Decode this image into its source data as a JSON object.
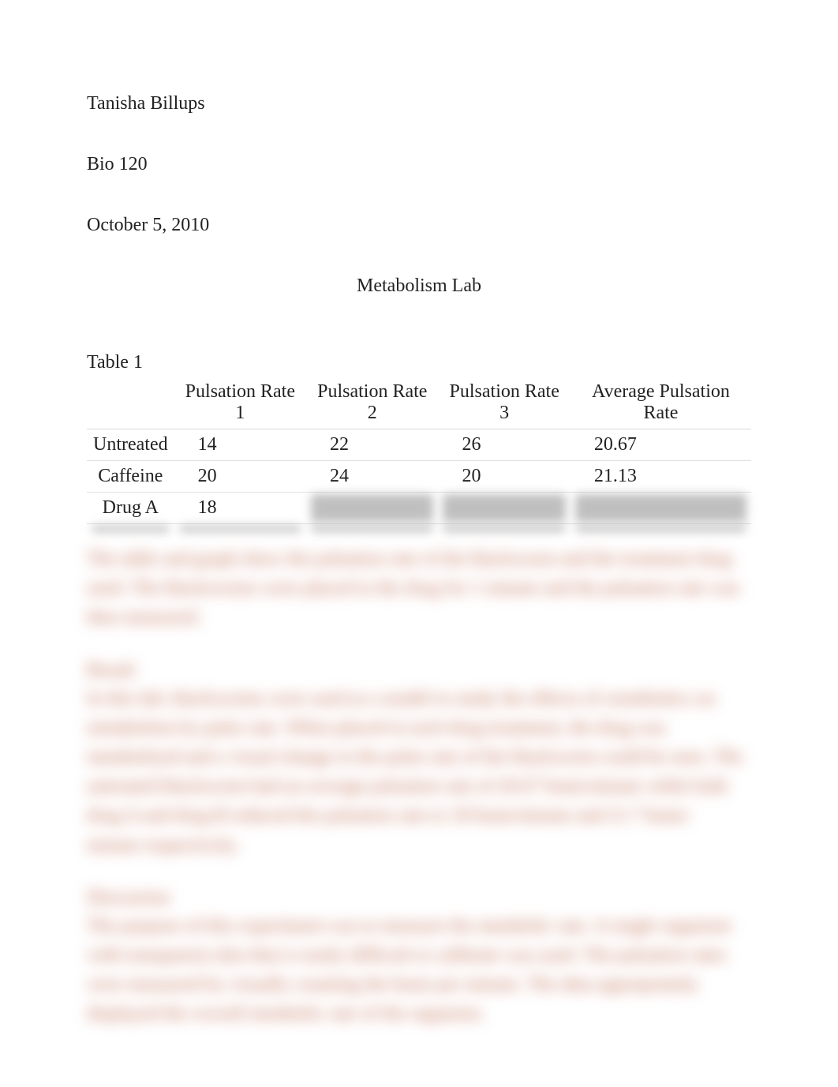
{
  "header": {
    "author": "Tanisha Billups",
    "course": "Bio 120",
    "date": "October 5, 2010",
    "title": "Metabolism Lab"
  },
  "table": {
    "label": "Table 1",
    "columns": [
      "",
      "Pulsation Rate 1",
      "Pulsation Rate 2",
      "Pulsation Rate 3",
      "Average Pulsation Rate"
    ],
    "rows": [
      {
        "label": "Untreated",
        "r1": "14",
        "r2": "22",
        "r3": "26",
        "avg": "20.67"
      },
      {
        "label": "Caffeine",
        "r1": "20",
        "r2": "24",
        "r3": "20",
        "avg": "21.13"
      },
      {
        "label": "Drug A",
        "r1": "18",
        "r2": "",
        "r3": "",
        "avg": ""
      },
      {
        "label": "",
        "r1": "",
        "r2": "",
        "r3": "",
        "avg": ""
      }
    ]
  },
  "blurred": {
    "caption_l1": "The table and graph show the pulsation rate of the blackworm and the treatment drug",
    "caption_l2": "used. The blackworms were placed in the drug for 1 minute and the pulsation rate was",
    "caption_l3": "then measured.",
    "results_h": "Result",
    "results_b1": "In this lab, blackworms were used as a model to study the effects of xenobiotics on",
    "results_b2": "metabolism by pulse rate. When placed in each drug treatment, the drug was",
    "results_b3": "metabolized and a visual change in the pulse rate of the blackworm could be seen. The",
    "results_b4": "untreated blackworm had an average pulsation rate of 20.67 beats/minute while both",
    "results_b5": "drug A and drug B reduced the pulsation rate to 18 beats/minute and 21.7 beats/",
    "results_b6": "minute respectively.",
    "discussion_h": "Discussion",
    "discussion_b1": "The purpose of this experiment was to measure the metabolic rate. A single organism",
    "discussion_b2": "with transparent skin that is easily difficult to calibrate was used. The pulsation rates",
    "discussion_b3": "were measured by visually counting the beats per minute. The data appropriately",
    "discussion_b4": "displayed the overall metabolic rate of the organism."
  }
}
